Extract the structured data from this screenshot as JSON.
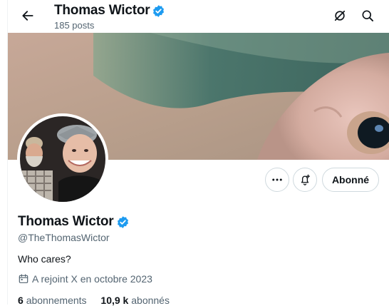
{
  "header": {
    "name": "Thomas Wictor",
    "posts": "185 posts"
  },
  "profile": {
    "name": "Thomas Wictor",
    "handle": "@TheThomasWictor",
    "bio": "Who cares?",
    "joined": "A rejoint X en octobre 2023",
    "following_count": "6",
    "following_label": "abonnements",
    "followers_count": "10,9 k",
    "followers_label": "abonnés"
  },
  "actions": {
    "follow_label": "Abonné"
  },
  "icons": {
    "back": "arrow-left-icon",
    "grok": "grok-icon",
    "search": "search-icon",
    "more": "more-dots-icon",
    "notify": "bell-plus-icon",
    "verified": "verified-badge-icon",
    "calendar": "calendar-icon"
  },
  "colors": {
    "verified": "#1d9bf0",
    "text": "#0f1419",
    "secondary": "#536471",
    "border": "#cfd9de"
  }
}
